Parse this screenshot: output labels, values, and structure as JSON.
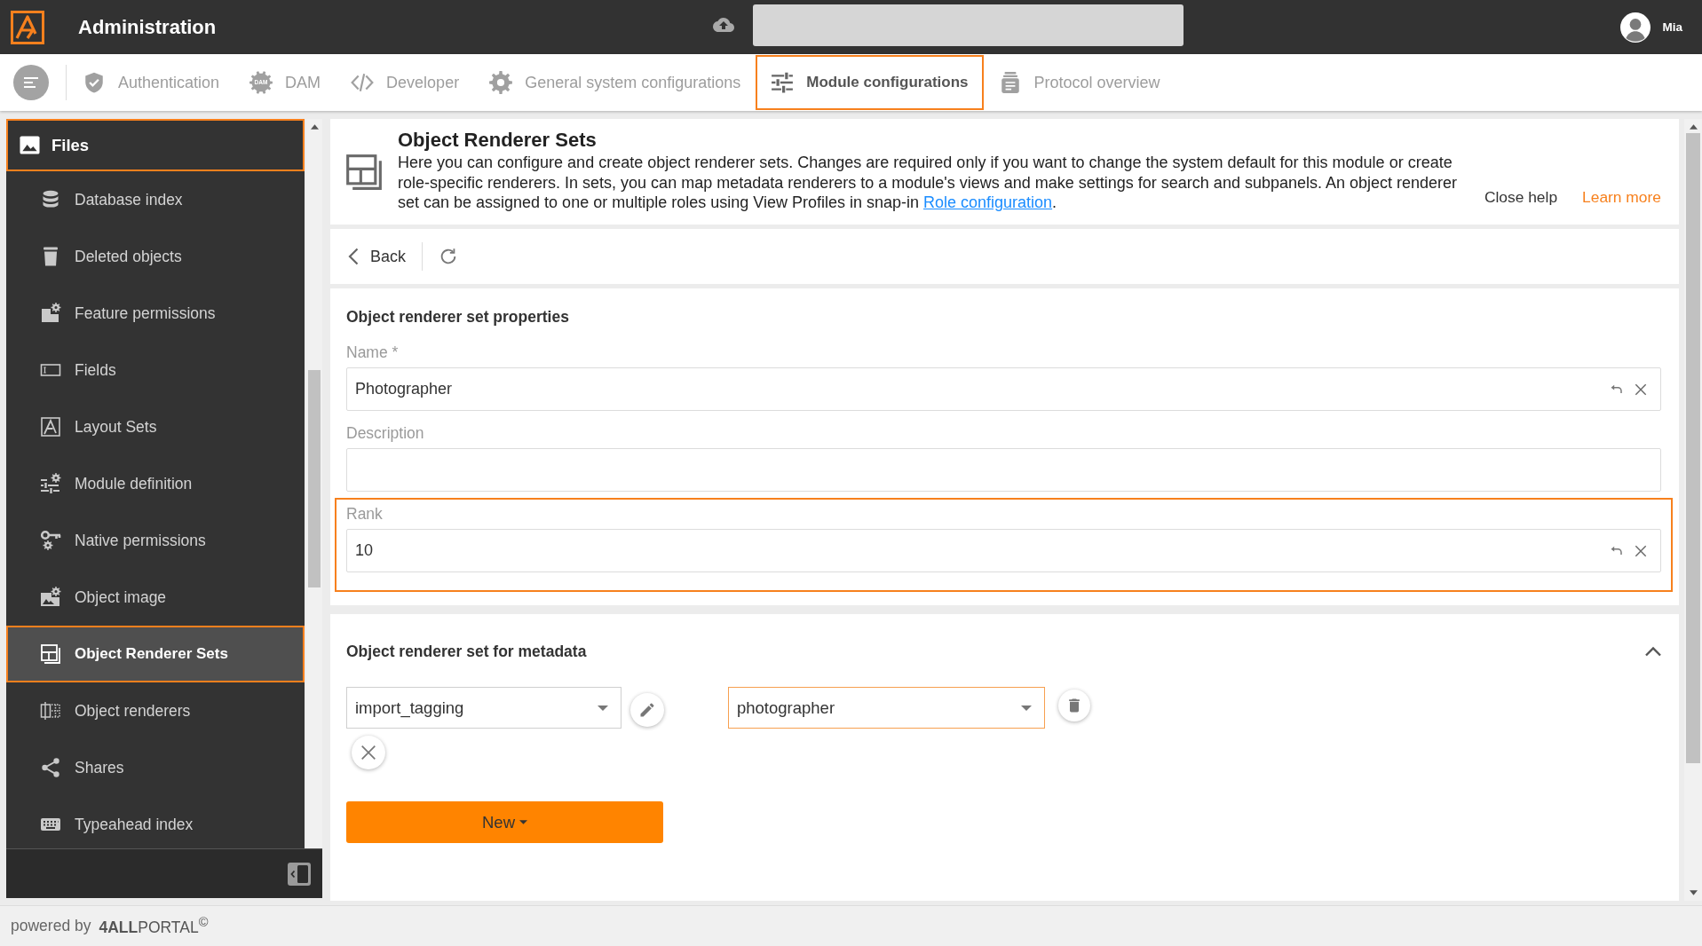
{
  "app": {
    "title": "Administration",
    "user": "Mia"
  },
  "tabs": [
    {
      "label": "Authentication",
      "selected": false
    },
    {
      "label": "DAM",
      "icon_text": "DAM",
      "selected": false
    },
    {
      "label": "Developer",
      "selected": false
    },
    {
      "label": "General system configurations",
      "selected": false
    },
    {
      "label": "Module configurations",
      "selected": true
    },
    {
      "label": "Protocol overview",
      "selected": false
    }
  ],
  "sidebar": {
    "header": {
      "label": "Files",
      "selected": true
    },
    "items": [
      {
        "label": "Database index",
        "selected": false
      },
      {
        "label": "Deleted objects",
        "selected": false
      },
      {
        "label": "Feature permissions",
        "selected": false
      },
      {
        "label": "Fields",
        "selected": false
      },
      {
        "label": "Layout Sets",
        "selected": false
      },
      {
        "label": "Module definition",
        "selected": false
      },
      {
        "label": "Native permissions",
        "selected": false
      },
      {
        "label": "Object image",
        "selected": false
      },
      {
        "label": "Object Renderer Sets",
        "selected": true
      },
      {
        "label": "Object renderers",
        "selected": false
      },
      {
        "label": "Shares",
        "selected": false
      },
      {
        "label": "Typeahead index",
        "selected": false
      }
    ]
  },
  "help": {
    "title": "Object Renderer Sets",
    "text": "Here you can configure and create object renderer sets. Changes are required only if you want to change the system default for this module or create role-specific renderers. In sets, you can map metadata renderers to a module's views and make settings for search and subpanels. An object renderer set can be assigned to one or multiple roles using View Profiles in snap-in ",
    "link": "Role configuration",
    "tail": ".",
    "close": "Close help",
    "learn_more": "Learn more"
  },
  "toolbar": {
    "back": "Back"
  },
  "properties": {
    "title": "Object renderer set properties",
    "fields": [
      {
        "label": "Name *",
        "value": "Photographer",
        "focused": false
      },
      {
        "label": "Description",
        "focused": false
      },
      {
        "label": "Rank",
        "value": "10",
        "focused": true
      }
    ]
  },
  "metadata": {
    "title": "Object renderer set for metadata",
    "expanded": true,
    "rows": [
      {
        "field": "import_tagging",
        "renderer": "photographer",
        "renderer_focused": true
      }
    ],
    "new_button": "New"
  },
  "footer": {
    "text": "powered by",
    "brand": "**4ALL**PORTAL$^{©}$"
  }
}
